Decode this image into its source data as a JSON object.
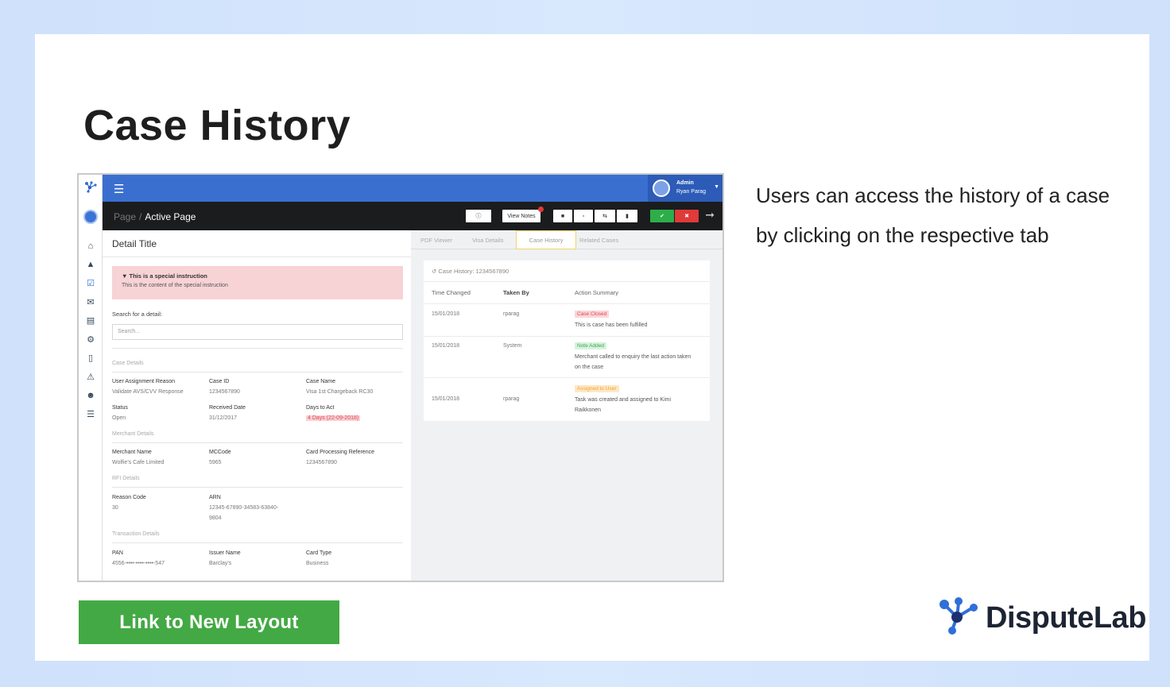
{
  "slide": {
    "title": "Case History",
    "description": "Users can access the history of a case by clicking on the respective tab",
    "link_button": "Link to New Layout",
    "brand": "DisputeLab"
  },
  "app": {
    "user": {
      "role": "Admin",
      "name": "Ryan Parag"
    },
    "breadcrumb": {
      "parent": "Page",
      "separator": "/",
      "current": "Active Page"
    },
    "toolbar": {
      "view_notes": "View Notes"
    },
    "detail_title": "Detail Title",
    "special_instruction": {
      "title": "This is a special instruction",
      "body": "This is the content of the special instruction"
    },
    "search": {
      "label": "Search for a detail:",
      "placeholder": "Search..."
    },
    "sections": {
      "case_details": "Case Details",
      "merchant_details": "Merchant Details",
      "rfi_details": "RFI Details",
      "transaction_details": "Transaction Details"
    },
    "fields": {
      "user_assignment_reason": {
        "label": "User Assignment Reason",
        "value": "Validate AVS/CVV Response"
      },
      "case_id": {
        "label": "Case ID",
        "value": "1234567890"
      },
      "case_name": {
        "label": "Case Name",
        "value": "Visa 1st Chargeback RC30"
      },
      "status": {
        "label": "Status",
        "value": "Open"
      },
      "received_date": {
        "label": "Received Date",
        "value": "31/12/2017"
      },
      "days_to_act": {
        "label": "Days to Act",
        "value": "4 Days (22-09-2018)"
      },
      "merchant_name": {
        "label": "Merchant Name",
        "value": "Wolfie's Cafe Limited"
      },
      "mccode": {
        "label": "MCCode",
        "value": "5965"
      },
      "card_processing_reference": {
        "label": "Card Processing Reference",
        "value": "1234567890"
      },
      "reason_code": {
        "label": "Reason Code",
        "value": "30"
      },
      "arn": {
        "label": "ARN",
        "value_line1": "12345-67890-34583-63840-",
        "value_line2": "9804"
      },
      "pan": {
        "label": "PAN",
        "value": "4556-••••-••••-••••-547"
      },
      "issuer_name": {
        "label": "Issuer Name",
        "value": "Barclay's"
      },
      "card_type": {
        "label": "Card Type",
        "value": "Business"
      }
    },
    "tabs": [
      "PDF Viewer",
      "Visa Details",
      "Case History",
      "Related Cases"
    ],
    "active_tab": "Case History",
    "history": {
      "header": "Case History: 1234567890",
      "columns": [
        "Time Changed",
        "Taken By",
        "Action Summary"
      ],
      "rows": [
        {
          "time": "15/01/2018",
          "by": "rparag",
          "badge": "Case Closed",
          "summary": "This is case has been fulfilled"
        },
        {
          "time": "15/01/2018",
          "by": "System",
          "badge": "Note Added",
          "summary": "Merchant called to enquiry the last action taken on the case"
        },
        {
          "time": "15/01/2018",
          "by": "rparag",
          "badge": "Assigned to User",
          "summary": "Task was created and assigned to Kimi Raikkonen"
        }
      ]
    }
  },
  "colors": {
    "topbar": "#3a6fd0",
    "subbar": "#1b1c1e",
    "link_button": "#43a944",
    "brand_blue": "#2f6fd8"
  }
}
